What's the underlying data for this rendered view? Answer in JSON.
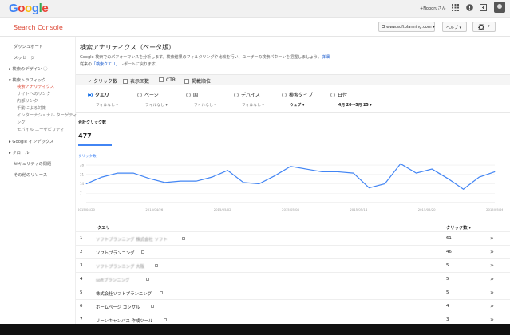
{
  "topbar": {
    "logo_letters": [
      {
        "ch": "G",
        "cls": "b"
      },
      {
        "ch": "o",
        "cls": "r"
      },
      {
        "ch": "o",
        "cls": "y"
      },
      {
        "ch": "g",
        "cls": "b"
      },
      {
        "ch": "l",
        "cls": "g"
      },
      {
        "ch": "e",
        "cls": "r"
      }
    ],
    "user": "+Noboruさん",
    "icons": [
      "apps-grid-icon",
      "notifications-icon",
      "share-icon"
    ]
  },
  "header": {
    "app_title": "Search Console",
    "site": "www.softplanning.com",
    "help": "ヘルプ",
    "settings_icon": "gear-icon"
  },
  "sidebar": {
    "items": [
      {
        "label": "ダッシュボード",
        "state": "normal"
      },
      {
        "label": "メッセージ",
        "state": "normal"
      },
      {
        "label": "▸ 検索のデザイン",
        "state": "normal"
      },
      {
        "label": "▾ 検索トラフィック",
        "state": "normal"
      },
      {
        "label": "検索アナリティクス",
        "state": "active"
      },
      {
        "label": "サイトへのリンク",
        "state": "sub"
      },
      {
        "label": "内部リンク",
        "state": "sub"
      },
      {
        "label": "手動による対策",
        "state": "sub"
      },
      {
        "label": "インターナショナル ターゲティ",
        "state": "sub"
      },
      {
        "label": "ング",
        "state": "sub"
      },
      {
        "label": "モバイル ユーザビリティ",
        "state": "sub"
      },
      {
        "label": "▸ Google インデックス",
        "state": "normal"
      },
      {
        "label": "▸ クロール",
        "state": "normal"
      },
      {
        "label": "セキュリティの問題",
        "state": "normal"
      },
      {
        "label": "その他のリソース",
        "state": "normal"
      }
    ]
  },
  "main": {
    "title": "検索アナリティクス（ベータ版）",
    "desc_line1": "Google 検索でのパフォーマンスを分析します。検索結果のフィルタリングや比較を行い、ユーザーの検索パターンを把握しましょう。",
    "desc_link1": "詳細",
    "desc_line2_pre": "従来の",
    "desc_link2": "「検索クエリ」",
    "desc_line2_post": "レポートに戻ります。",
    "metrics_checkboxes": [
      {
        "label": "クリック数",
        "checked": true
      },
      {
        "label": "表示回数",
        "checked": false
      },
      {
        "label": "CTR",
        "checked": false
      },
      {
        "label": "掲載順位",
        "checked": false
      }
    ],
    "dimensions": [
      {
        "label": "クエリ",
        "filter": "フィルなし ▾",
        "selected": true
      },
      {
        "label": "ページ",
        "filter": "フィルなし ▾",
        "selected": false
      },
      {
        "label": "国",
        "filter": "フィルなし ▾",
        "selected": false
      },
      {
        "label": "デバイス",
        "filter": "フィルなし ▾",
        "selected": false
      },
      {
        "label": "検索タイプ",
        "filter": "ウェブ ▾",
        "selected": false
      },
      {
        "label": "日付",
        "filter": "4月 20〜5月 25 ▾",
        "selected": false
      }
    ],
    "metric_card": {
      "name": "合計クリック数",
      "value": "477"
    },
    "table": {
      "headers": {
        "num": "",
        "query": "クエリ",
        "clicks": "クリック数 ▾"
      },
      "rows": [
        {
          "n": "1",
          "query": "ソフトプランニング 株式会社 ソフト",
          "blurred": true,
          "clicks": "61"
        },
        {
          "n": "2",
          "query": "ソフトプランニング",
          "blurred": false,
          "clicks": "46"
        },
        {
          "n": "3",
          "query": "ソフトプランニング 大阪",
          "blurred": true,
          "clicks": "5"
        },
        {
          "n": "4",
          "query": "softプランニング",
          "blurred": true,
          "clicks": "5"
        },
        {
          "n": "5",
          "query": "株式会社ソフトプランニング",
          "blurred": false,
          "clicks": "5"
        },
        {
          "n": "6",
          "query": "ホームページ コンサル",
          "blurred": false,
          "clicks": "4"
        },
        {
          "n": "7",
          "query": "リーンキャンバス 作成ツール",
          "blurred": false,
          "clicks": "3"
        }
      ]
    }
  },
  "chart_data": {
    "type": "line",
    "series": [
      {
        "name": "クリック数",
        "values": [
          14,
          19,
          22,
          22,
          18,
          15,
          16,
          16,
          19,
          24,
          15,
          14,
          20,
          27,
          25,
          23,
          23,
          22,
          11,
          14,
          29,
          22,
          25,
          18,
          10,
          19,
          23
        ]
      }
    ],
    "x_tick_labels": [
      "2015/04/20",
      "2015/04/26",
      "2015/05/02",
      "2015/05/08",
      "2015/05/14",
      "2015/05/20",
      "2015/05/26"
    ],
    "y_tick_labels": [
      "28",
      "21",
      "14",
      "7"
    ],
    "ylim": [
      0,
      31
    ],
    "color": "#4285f4",
    "grid": true
  }
}
